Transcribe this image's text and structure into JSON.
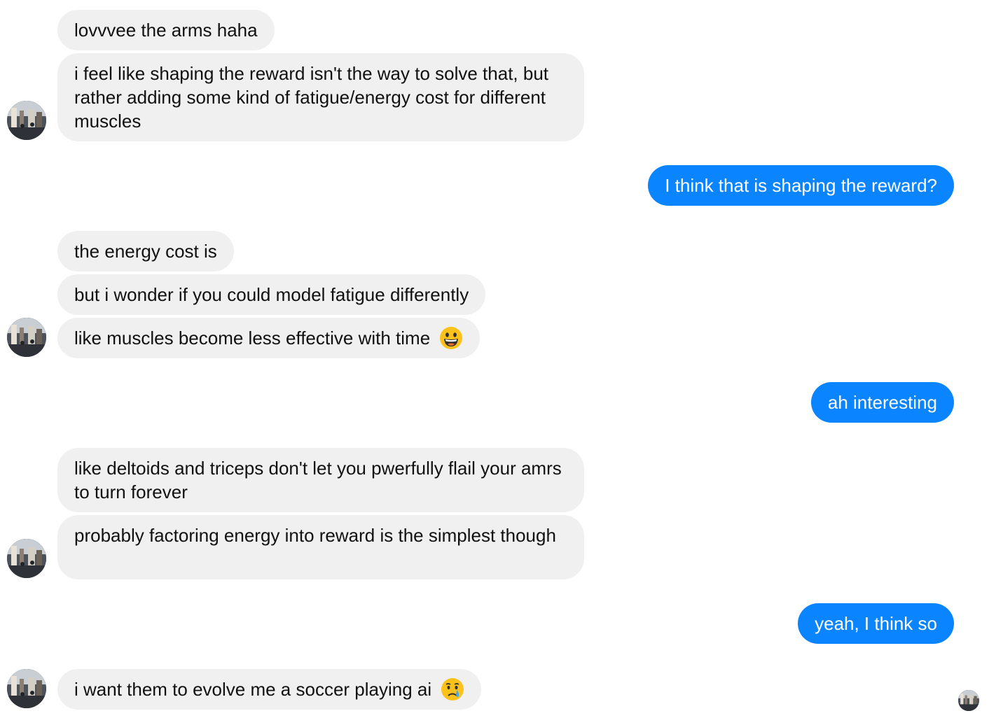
{
  "messages": [
    {
      "text": "lovvvee the arms haha"
    },
    {
      "text": "i feel like shaping the reward isn't the way to solve that, but rather adding some kind of fatigue/energy cost  for different muscles"
    },
    {
      "text": "I think that is shaping the reward?"
    },
    {
      "text": "the energy cost is"
    },
    {
      "text": "but i wonder if you could model fatigue differently"
    },
    {
      "text": "like muscles become less effective with time",
      "emoji": "grinning-face-emoji"
    },
    {
      "text": "ah interesting"
    },
    {
      "text": "like deltoids and triceps don't let you pwerfully flail your amrs to turn forever"
    },
    {
      "text": "probably factoring energy into reward is the simplest though"
    },
    {
      "text": "yeah, I think so"
    },
    {
      "text": "i want them to evolve me a soccer playing ai",
      "emoji": "crying-face-emoji"
    }
  ],
  "colors": {
    "incoming_bubble": "#f0f0f0",
    "outgoing_bubble": "#0a84ff",
    "outgoing_text": "#ffffff"
  },
  "icons": {
    "contact_avatar": "contact-avatar",
    "seen_indicator": "seen-avatar"
  }
}
